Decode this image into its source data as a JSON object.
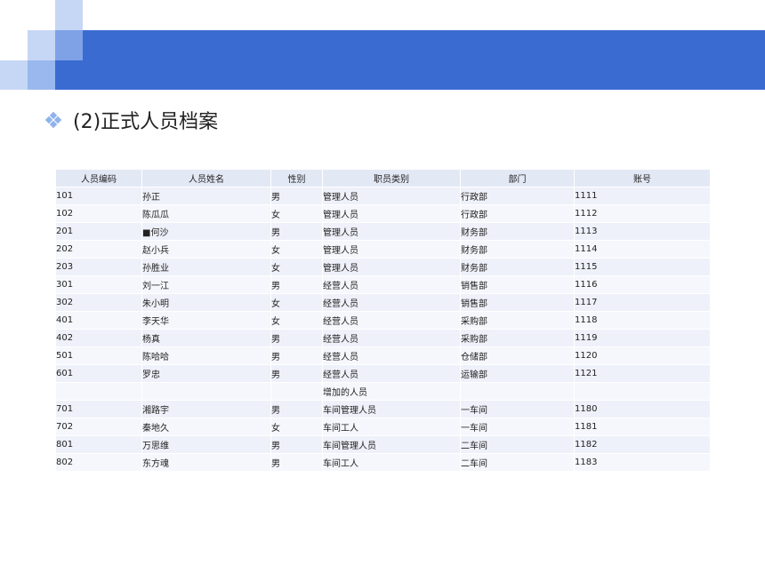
{
  "slide": {
    "title": "(2)正式人员档案",
    "colors": {
      "banner": "#3a6bd1",
      "light_square": "#c6d7f5",
      "table_header": "#e3e8f5"
    }
  },
  "table": {
    "headers": [
      "人员编码",
      "人员姓名",
      "性别",
      "职员类别",
      "部门",
      "账号"
    ],
    "rows": [
      [
        "101",
        "孙正",
        "男",
        "管理人员",
        "行政部",
        "1111"
      ],
      [
        "102",
        "陈瓜瓜",
        "女",
        "管理人员",
        "行政部",
        "1112"
      ],
      [
        "201",
        "■何沙",
        "男",
        "管理人员",
        "财务部",
        "1113"
      ],
      [
        "202",
        "赵小兵",
        "女",
        "管理人员",
        "财务部",
        "1114"
      ],
      [
        "203",
        "孙胜业",
        "女",
        "管理人员",
        "财务部",
        "1115"
      ],
      [
        "301",
        "刘一江",
        "男",
        "经营人员",
        "销售部",
        "1116"
      ],
      [
        "302",
        "朱小明",
        "女",
        "经营人员",
        "销售部",
        "1117"
      ],
      [
        "401",
        "李天华",
        "女",
        "经营人员",
        "采购部",
        "1118"
      ],
      [
        "402",
        "杨真",
        "男",
        "经营人员",
        "采购部",
        "1119"
      ],
      [
        "501",
        "陈哈哈",
        "男",
        "经营人员",
        "仓储部",
        "1120"
      ],
      [
        "601",
        "罗忠",
        "男",
        "经营人员",
        "运输部",
        "1121"
      ],
      [
        "",
        "",
        "",
        "增加的人员",
        "",
        ""
      ],
      [
        "701",
        "湘路宇",
        "男",
        "车间管理人员",
        "一车间",
        "1180"
      ],
      [
        "702",
        "秦地久",
        "女",
        "车间工人",
        "一车间",
        "1181"
      ],
      [
        "801",
        "万思维",
        "男",
        "车间管理人员",
        "二车间",
        "1182"
      ],
      [
        "802",
        "东方魂",
        "男",
        "车间工人",
        "二车间",
        "1183"
      ]
    ]
  }
}
